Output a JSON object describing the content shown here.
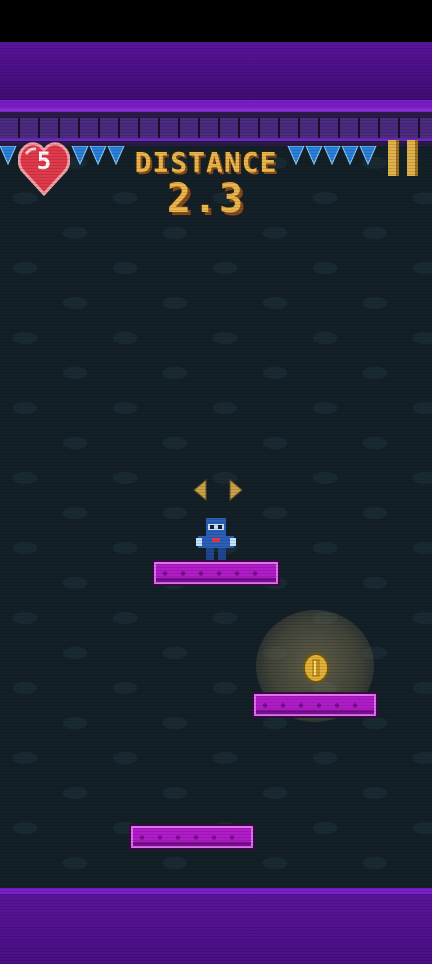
{
  "hud": {
    "lives": "5",
    "distance_label": "DISTANCE",
    "distance_value": "2.3"
  },
  "icons": {
    "lives": "heart-icon",
    "pause": "pause-icon",
    "move_hint": "left-right-arrows-icon",
    "player": "ninja-player-icon",
    "coin": "coin-icon"
  },
  "colors": {
    "hud_gold": "#e8b84e",
    "platform_magenta": "#b01cc8",
    "frame_purple": "#5a149a",
    "background": "#142028",
    "heart_red": "#e0394a",
    "spike_blue": "#2a7fd8"
  }
}
